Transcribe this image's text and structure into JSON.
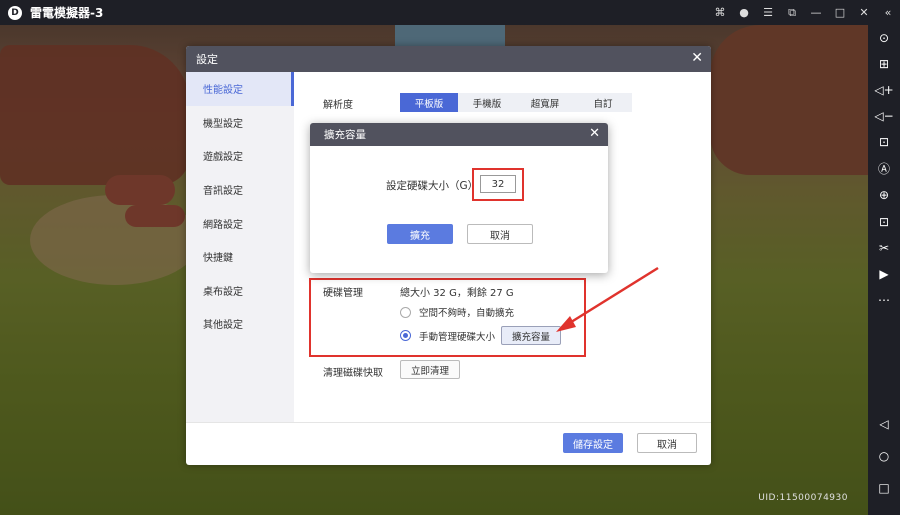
{
  "window": {
    "logo_text": "D",
    "title": "雷電模擬器-3",
    "title_icons": [
      "gamepad-icon",
      "user-icon",
      "menu-icon",
      "restore-small-icon",
      "minimize-icon",
      "maximize-icon",
      "close-icon",
      "collapse-icon"
    ],
    "title_glyphs": [
      "⌘",
      "●",
      "☰",
      "⧉",
      "—",
      "□",
      "✕",
      "«"
    ]
  },
  "game": {
    "uid_text": "UID:11500074930"
  },
  "right_toolbar": {
    "icons": [
      "target-icon",
      "keyboard-icon",
      "volume-up-icon",
      "volume-down-icon",
      "screenshot-icon",
      "auto-script-icon",
      "add-window-icon",
      "apk-install-icon",
      "scissors-icon",
      "record-icon",
      "more-icon",
      "back-icon",
      "home-icon",
      "recent-apps-icon"
    ],
    "glyphs": [
      "⊙",
      "⊞",
      "◁+",
      "◁−",
      "⊡",
      "Ⓐ",
      "⊕",
      "⊡",
      "✂",
      "▶",
      "⋯",
      "◁",
      "○",
      "□"
    ]
  },
  "settings": {
    "title": "設定",
    "close_glyph": "✕",
    "nav": [
      "性能設定",
      "機型設定",
      "遊戲設定",
      "音訊設定",
      "網路設定",
      "快捷鍵",
      "桌布設定",
      "其他設定"
    ],
    "resolution_label": "解析度",
    "resolution_options": [
      "平板版",
      "手機版",
      "超寬屏",
      "自訂"
    ],
    "resolution_selected": 0,
    "disk_label": "硬碟管理",
    "disk_info": "總大小 32 G，剩餘 27 G",
    "radio_auto": "空間不夠時，自動擴充",
    "radio_manual": "手動管理硬碟大小",
    "expand_button": "擴充容量",
    "clear_label": "清理磁碟快取",
    "clear_button": "立即清理",
    "save_button": "儲存設定",
    "cancel_button": "取消"
  },
  "expand_dialog": {
    "title": "擴充容量",
    "close_glyph": "✕",
    "size_label": "設定硬碟大小（G）",
    "size_value": "32",
    "confirm_button": "擴充",
    "cancel_button": "取消"
  },
  "colors": {
    "accent": "#4a68d6",
    "highlight": "#e0332d",
    "dialog_header": "#51525e"
  }
}
